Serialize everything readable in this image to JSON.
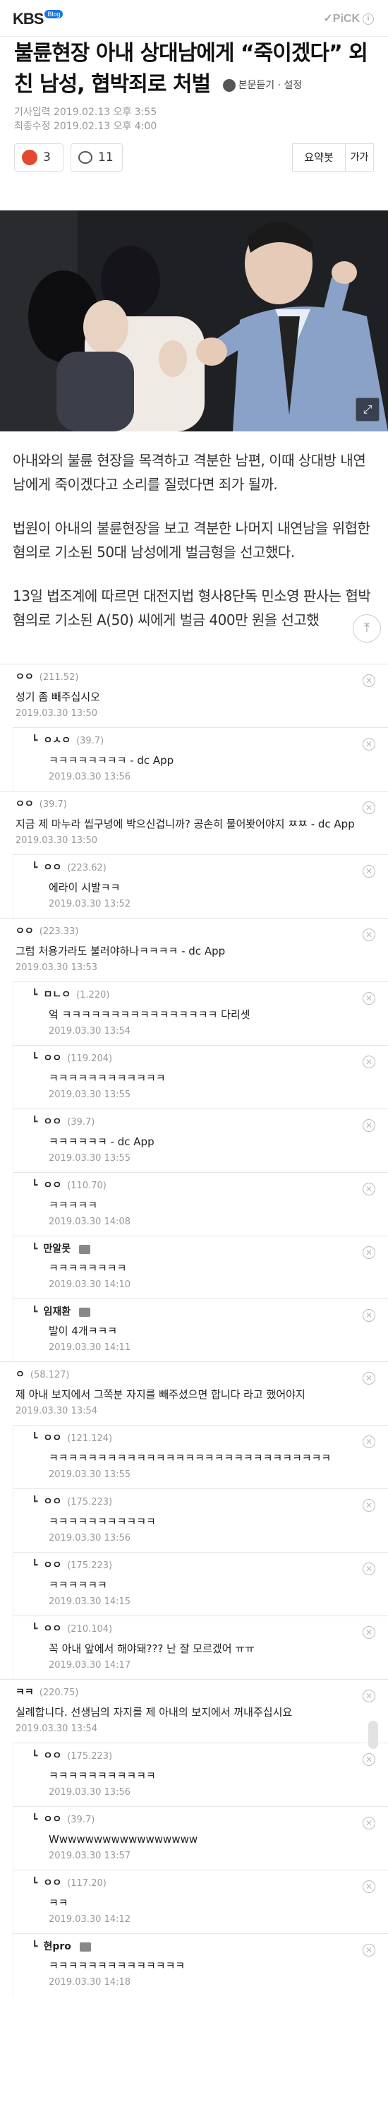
{
  "header": {
    "logo": "KBS",
    "logo_badge": "Blog",
    "pick_label": "✓PiCK",
    "pick_info": "i"
  },
  "article": {
    "title_line1": "불륜현장 아내 상대남에게 “죽이겠다” 외",
    "title_line2": "친 남성, 협박죄로 처벌",
    "listen_label": "본문듣기",
    "settings_label": "· 설정",
    "published": "기사입력  2019.02.13 오후 3:55",
    "modified": "최종수정  2019.02.13 오후 4:00",
    "like_count": "3",
    "comment_count": "11",
    "summary_label": "요약봇",
    "font_label": "가가",
    "paragraphs": [
      "아내와의 불륜 현장을 목격하고 격분한 남편, 이때 상대방 내연남에게 죽이겠다고 소리를 질렀다면 죄가 될까.",
      "법원이 아내의 불륜현장을 보고 격분한 나머지 내연남을 위협한 혐의로 기소된 50대 남성에게 벌금형을 선고했다.",
      "13일 법조계에 따르면 대전지법 형사8단독 민소영 판사는 협박 혐의로 기소된 A(50) 씨에게 벌금 400만 원을 선고했"
    ]
  },
  "comments": [
    {
      "name": "ㅇㅇ",
      "ip": "(211.52)",
      "text": "성기 좀 빼주십시오",
      "date": "2019.03.30 13:50",
      "child": false,
      "badge": false
    },
    {
      "name": "ㅇㅅㅇ",
      "ip": "(39.7)",
      "text": "ㅋㅋㅋㅋㅋㅋㅋㅋ - dc App",
      "date": "2019.03.30 13:56",
      "child": true,
      "badge": false
    },
    {
      "name": "ㅇㅇ",
      "ip": "(39.7)",
      "text": "지금 제 마누라 씹구녕에 박으신겁니까? 공손히 물어봣어야지 ㅉㅉ - dc App",
      "date": "2019.03.30 13:50",
      "child": false,
      "badge": false
    },
    {
      "name": "ㅇㅇ",
      "ip": "(223.62)",
      "text": "에라이 시발ㅋㅋ",
      "date": "2019.03.30 13:52",
      "child": true,
      "badge": false
    },
    {
      "name": "ㅇㅇ",
      "ip": "(223.33)",
      "text": "그럼 처용가라도 불러야하나ㅋㅋㅋㅋ - dc App",
      "date": "2019.03.30 13:53",
      "child": false,
      "badge": false
    },
    {
      "name": "ㅁㄴㅇ",
      "ip": "(1.220)",
      "text": "엌 ㅋㅋㅋㅋㅋㅋㅋㅋㅋㅋㅋㅋㅋㅋㅋㅋ 다리셋",
      "date": "2019.03.30 13:54",
      "child": true,
      "badge": false
    },
    {
      "name": "ㅇㅇ",
      "ip": "(119.204)",
      "text": "ㅋㅋㅋㅋㅋㅋㅋㅋㅋㅋㅋㅋ",
      "date": "2019.03.30 13:55",
      "child": true,
      "badge": false
    },
    {
      "name": "ㅇㅇ",
      "ip": "(39.7)",
      "text": "ㅋㅋㅋㅋㅋㅋ - dc App",
      "date": "2019.03.30 13:55",
      "child": true,
      "badge": false
    },
    {
      "name": "ㅇㅇ",
      "ip": "(110.70)",
      "text": "ㅋㅋㅋㅋㅋ",
      "date": "2019.03.30 14:08",
      "child": true,
      "badge": false
    },
    {
      "name": "만알못",
      "ip": "",
      "text": "ㅋㅋㅋㅋㅋㅋㅋㅋ",
      "date": "2019.03.30 14:10",
      "child": true,
      "badge": true
    },
    {
      "name": "임재환",
      "ip": "",
      "text": "발이 4개ㅋㅋㅋ",
      "date": "2019.03.30 14:11",
      "child": true,
      "badge": true
    },
    {
      "name": "ㅇ",
      "ip": "(58.127)",
      "text": "제 아내 보지에서 그쪽분 자지를 빼주셨으면 합니다 라고 했어야지",
      "date": "2019.03.30 13:54",
      "child": false,
      "badge": false
    },
    {
      "name": "ㅇㅇ",
      "ip": "(121.124)",
      "text": "ㅋㅋㅋㅋㅋㅋㅋㅋㅋㅋㅋㅋㅋㅋㅋㅋㅋㅋㅋㅋㅋㅋㅋㅋㅋㅋㅋㅋㅋ",
      "date": "2019.03.30 13:55",
      "child": true,
      "badge": false
    },
    {
      "name": "ㅇㅇ",
      "ip": "(175.223)",
      "text": "ㅋㅋㅋㅋㅋㅋㅋㅋㅋㅋㅋ",
      "date": "2019.03.30 13:56",
      "child": true,
      "badge": false
    },
    {
      "name": "ㅇㅇ",
      "ip": "(175.223)",
      "text": "ㅋㅋㅋㅋㅋㅋ",
      "date": "2019.03.30 14:15",
      "child": true,
      "badge": false
    },
    {
      "name": "ㅇㅇ",
      "ip": "(210.104)",
      "text": "꼭 아내 앞에서 해야돼??? 난 잘 모르겠어 ㅠㅠ",
      "date": "2019.03.30 14:17",
      "child": true,
      "badge": false
    },
    {
      "name": "ㅋㅋ",
      "ip": "(220.75)",
      "text": "실례합니다. 선생님의 자지를 제 아내의 보지에서 꺼내주십시요",
      "date": "2019.03.30 13:54",
      "child": false,
      "badge": false
    },
    {
      "name": "ㅇㅇ",
      "ip": "(175.223)",
      "text": "ㅋㅋㅋㅋㅋㅋㅋㅋㅋㅋㅋ",
      "date": "2019.03.30 13:56",
      "child": true,
      "badge": false
    },
    {
      "name": "ㅇㅇ",
      "ip": "(39.7)",
      "text": "Wwwwwwwwwwwwwwwww",
      "date": "2019.03.30 13:57",
      "child": true,
      "badge": false
    },
    {
      "name": "ㅇㅇ",
      "ip": "(117.20)",
      "text": "ㅋㅋ",
      "date": "2019.03.30 14:12",
      "child": true,
      "badge": false
    },
    {
      "name": "현pro",
      "ip": "",
      "text": "ㅋㅋㅋㅋㅋㅋㅋㅋㅋㅋㅋㅋㅋㅋ",
      "date": "2019.03.30 14:18",
      "child": true,
      "badge": true
    }
  ]
}
